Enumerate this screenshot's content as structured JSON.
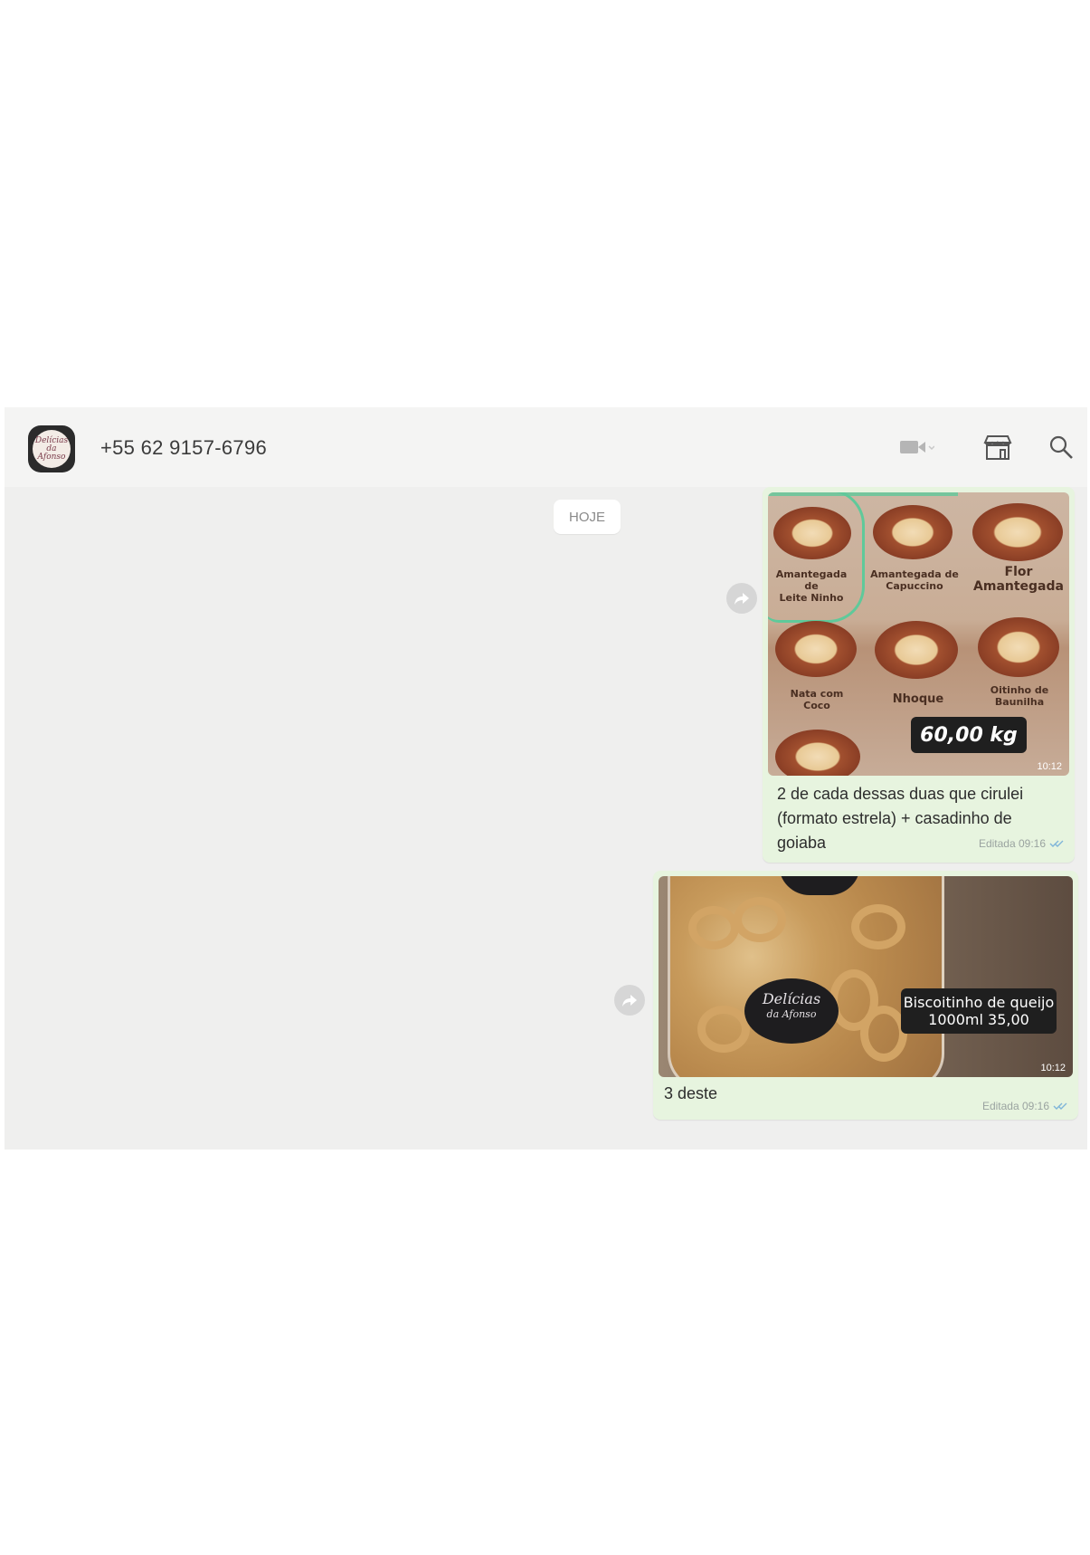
{
  "header": {
    "avatar_text": "Delícias da Afonso",
    "contact": "+55 62 9157-6796",
    "video_label": "▾"
  },
  "chat": {
    "date_divider": "HOJE",
    "messages": [
      {
        "image": {
          "items": [
            {
              "label_line1": "Amantegada de",
              "label_line2": "Leite Ninho"
            },
            {
              "label_line1": "Amantegada de",
              "label_line2": "Capuccino"
            },
            {
              "label_line1": "Flor",
              "label_line2": "Amantegada"
            },
            {
              "label_line1": "Nata com",
              "label_line2": "Coco"
            },
            {
              "label_line1": "Nhoque",
              "label_line2": ""
            },
            {
              "label_line1": "Oitinho de",
              "label_line2": "Baunilha"
            }
          ],
          "price": "60,00 kg",
          "time": "10:12"
        },
        "caption": "2 de cada dessas duas que cirulei (formato estrela) + casadinho de goiaba",
        "meta": "Editada 09:16"
      },
      {
        "image": {
          "jar_label_line1": "Delícias",
          "jar_label_line2": "da Afonso",
          "price_line1": "Biscoitinho de queijo",
          "price_line2": "1000ml 35,00",
          "time": "10:12"
        },
        "caption": "3 deste",
        "meta": "Editada 09:16"
      }
    ]
  }
}
